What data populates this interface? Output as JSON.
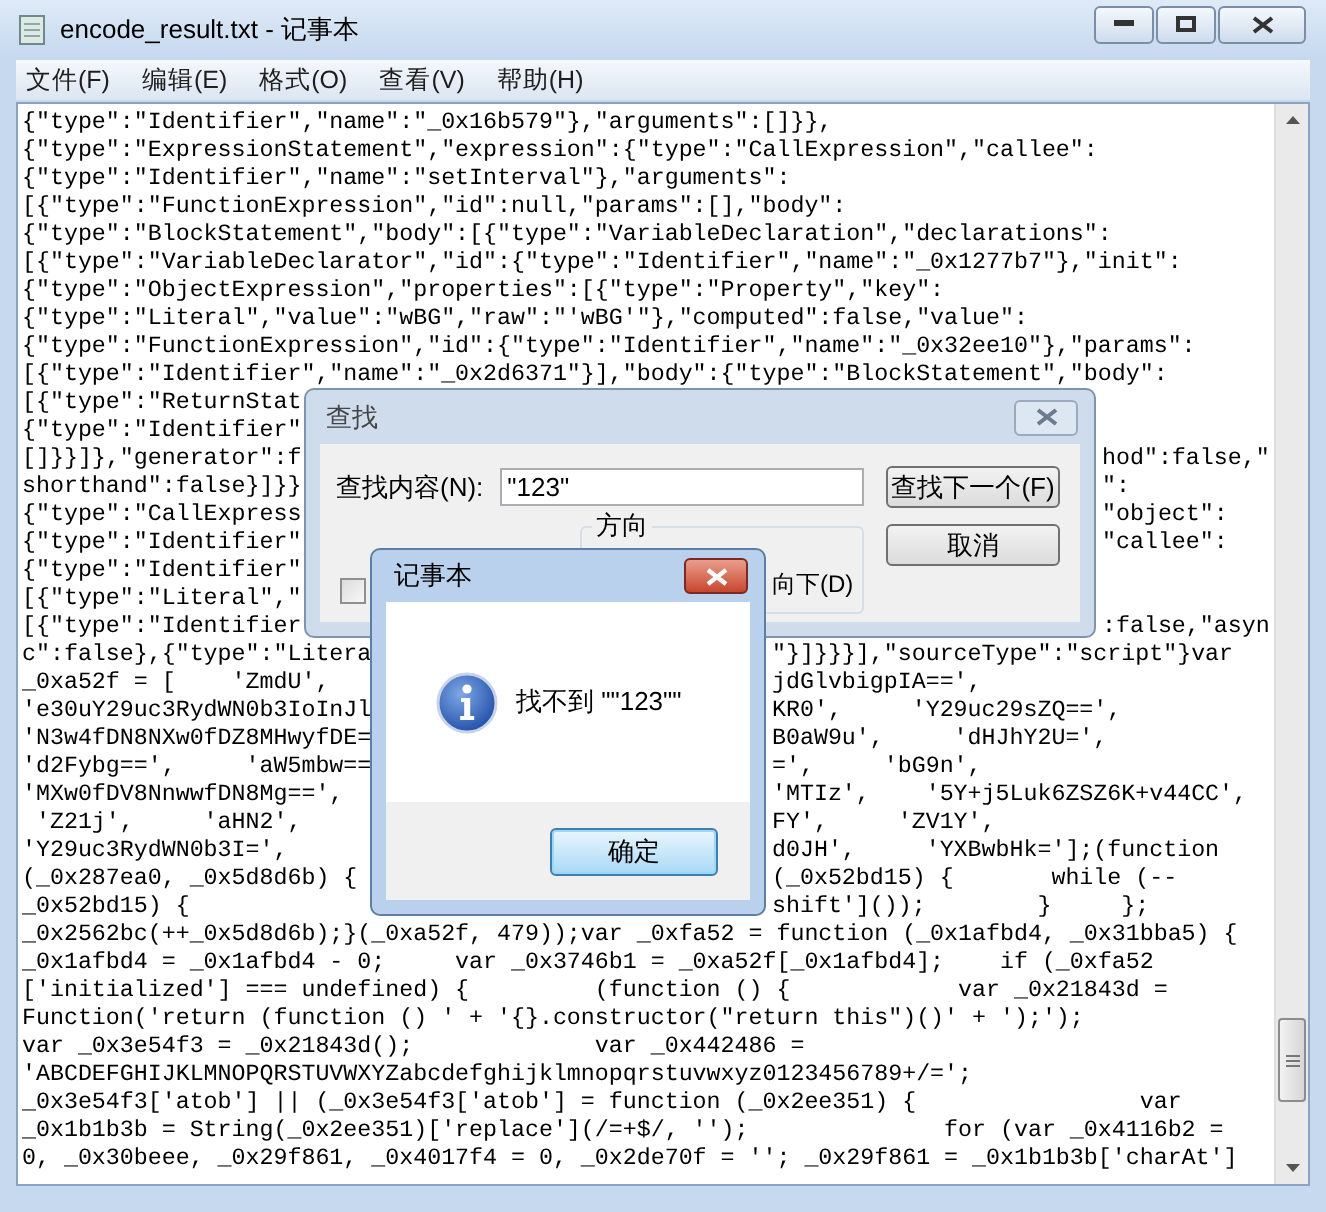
{
  "window": {
    "title": "encode_result.txt - 记事本"
  },
  "menu": [
    {
      "label": "文件(F)"
    },
    {
      "label": "编辑(E)"
    },
    {
      "label": "格式(O)"
    },
    {
      "label": "查看(V)"
    },
    {
      "label": "帮助(H)"
    }
  ],
  "editor": {
    "lines": [
      {
        "text": "{\"type\":\"Identifier\",\"name\":\"_0x16b579\"},\"arguments\":[]}},"
      },
      {
        "text": "{\"type\":\"ExpressionStatement\",\"expression\":{\"type\":\"CallExpression\",\"callee\":"
      },
      {
        "text": "{\"type\":\"Identifier\",\"name\":\"setInterval\"},\"arguments\":"
      },
      {
        "text": "[{\"type\":\"FunctionExpression\",\"id\":null,\"params\":[],\"body\":"
      },
      {
        "text": "{\"type\":\"BlockStatement\",\"body\":[{\"type\":\"VariableDeclaration\",\"declarations\":"
      },
      {
        "text": "[{\"type\":\"VariableDeclarator\",\"id\":{\"type\":\"Identifier\",\"name\":\"_0x1277b7\"},\"init\":"
      },
      {
        "text": "{\"type\":\"ObjectExpression\",\"properties\":[{\"type\":\"Property\",\"key\":"
      },
      {
        "text": "{\"type\":\"Literal\",\"value\":\"wBG\",\"raw\":\"'wBG'\"},\"computed\":false,\"value\":"
      },
      {
        "text": "{\"type\":\"FunctionExpression\",\"id\":{\"type\":\"Identifier\",\"name\":\"_0x32ee10\"},\"params\":"
      },
      {
        "text": "[{\"type\":\"Identifier\",\"name\":\"_0x2d6371\"}],\"body\":{\"type\":\"BlockStatement\",\"body\":"
      },
      {
        "text": "[{\"type\":\"ReturnStat"
      },
      {
        "text": "{\"type\":\"Identifier\""
      },
      {
        "text": "[]}}]},\"generator\":f",
        "right": "hod\":false,\""
      },
      {
        "text": "shorthand\":false}]}}",
        "right": "\":"
      },
      {
        "text": "{\"type\":\"CallExpress",
        "right": "\"object\":"
      },
      {
        "text": "{\"type\":\"Identifier\"",
        "right": "\"callee\":"
      },
      {
        "text": "{\"type\":\"Identifier\""
      },
      {
        "text": "[{\"type\":\"Literal\",\""
      },
      {
        "text": "[{\"type\":\"Identifier",
        "right": ":false,\"asyn"
      },
      {
        "text": "c\":false},{\"type\":\"Litera",
        "right": "\"}]}}}],\"sourceType\":\"script\"}var"
      },
      {
        "text": "_0xa52f = [    'ZmdU',",
        "right": "jdGlvbigpIA==',"
      },
      {
        "text": "'e30uY29uc3RydWN0b3IoInJl",
        "right": "KR0',     'Y29uc29sZQ==',"
      },
      {
        "text": "'N3w4fDN8NXw0fDZ8MHwyfDE=",
        "right": "B0aW9u',     'dHJhY2U=',"
      },
      {
        "text": "'d2Fybg==',     'aW5mbw==",
        "right": "=',     'bG9n',"
      },
      {
        "text": "'MXw0fDV8NnwwfDN8Mg==',",
        "right": "'MTIz',    '5Y+j5Luk6ZSZ6K+v44CC',"
      },
      {
        "text": " 'Z21j',     'aHN2',",
        "right": "FY',     'ZV1Y',"
      },
      {
        "text": "'Y29uc3RydWN0b3I=',",
        "right": "d0JH',     'YXBwbHk='];(function"
      },
      {
        "text": "(_0x287ea0, _0x5d8d6b) {",
        "right": "(_0x52bd15) {       while (--"
      },
      {
        "text": "_0x52bd15) {",
        "right": "shift']());        }     };"
      },
      {
        "text": "_0x2562bc(++_0x5d8d6b);}(_0xa52f, 479));var _0xfa52 = function (_0x1afbd4, _0x31bba5) {"
      },
      {
        "text": "_0x1afbd4 = _0x1afbd4 - 0;     var _0x3746b1 = _0xa52f[_0x1afbd4];    if (_0xfa52"
      },
      {
        "text": "['initialized'] === undefined) {         (function () {            var _0x21843d ="
      },
      {
        "text": "Function('return (function () ' + '{}.constructor(\"return this\")()' + ');');"
      },
      {
        "text": "var _0x3e54f3 = _0x21843d();             var _0x442486 ="
      },
      {
        "text": "'ABCDEFGHIJKLMNOPQRSTUVWXYZabcdefghijklmnopqrstuvwxyz0123456789+/=';"
      },
      {
        "text": "_0x3e54f3['atob'] || (_0x3e54f3['atob'] = function (_0x2ee351) {                var"
      },
      {
        "text": "_0x1b1b3b = String(_0x2ee351)['replace'](/=+$/, '');              for (var _0x4116b2 ="
      },
      {
        "text": "0, _0x30beee, _0x29f861, _0x4017f4 = 0, _0x2de70f = ''; _0x29f861 = _0x1b1b3b['charAt']"
      }
    ]
  },
  "find_dialog": {
    "title": "查找",
    "find_label": "查找内容(N):",
    "find_value": "\"123\"",
    "find_next_button": "查找下一个(F)",
    "cancel_button": "取消",
    "direction_label": "方向",
    "down_option": "向下(D)",
    "match_case": {
      "checked": false
    }
  },
  "message_box": {
    "title": "记事本",
    "message": "找不到 \"\"123\"\"",
    "ok_button": "确定"
  }
}
